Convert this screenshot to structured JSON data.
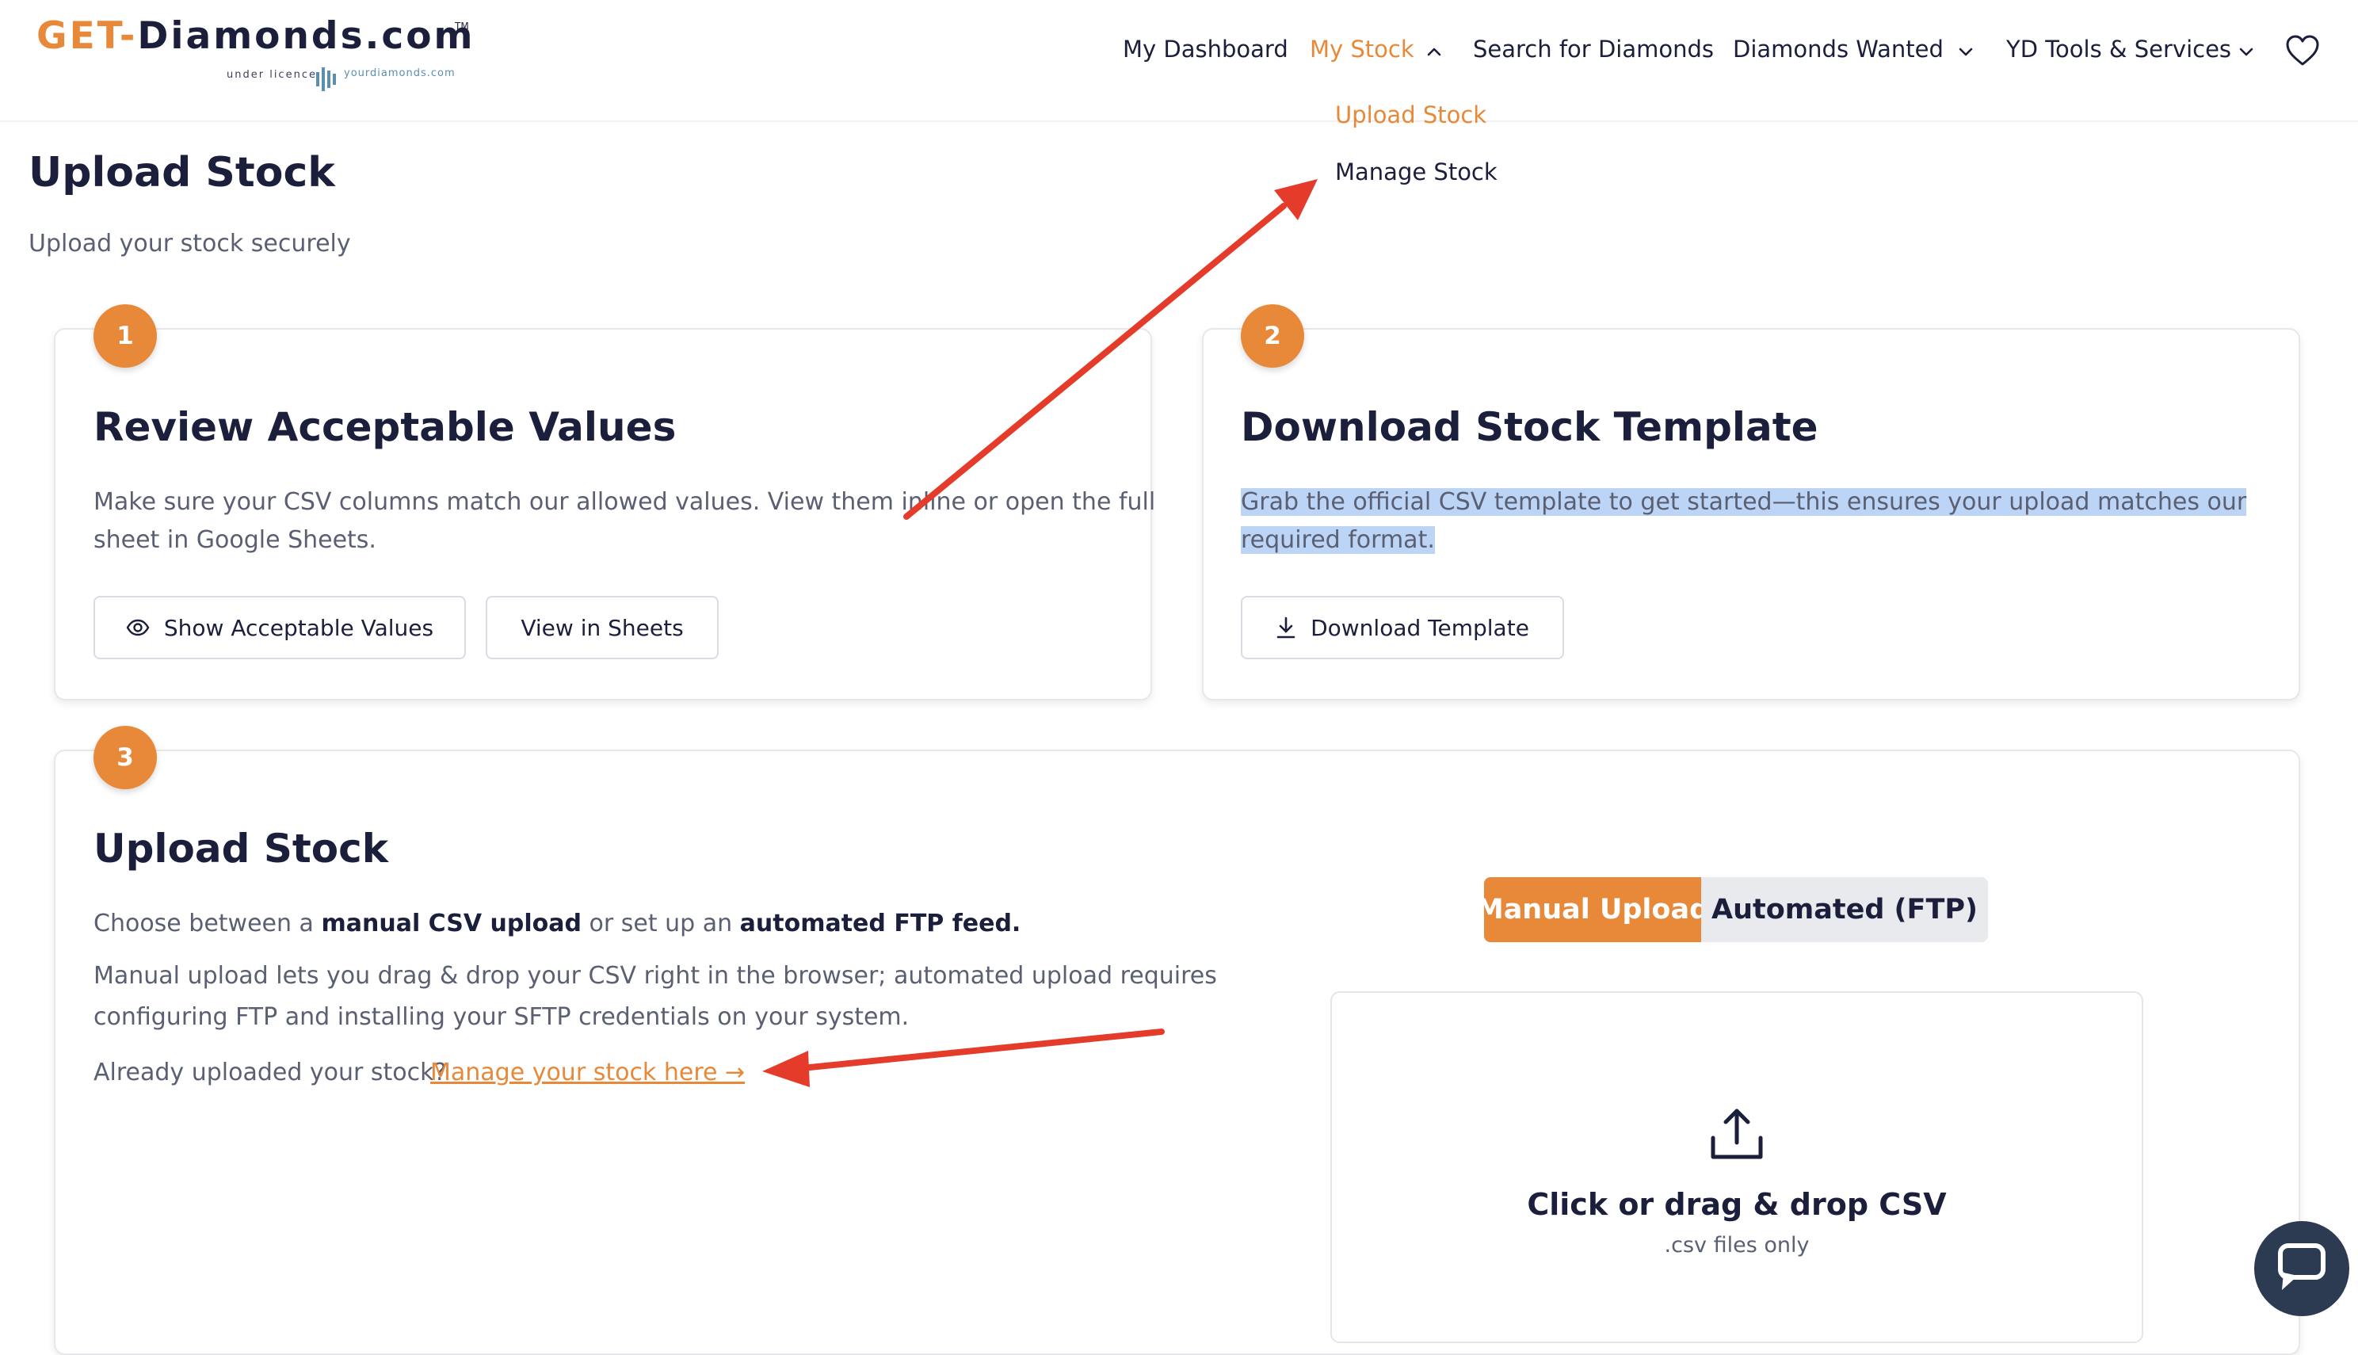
{
  "header": {
    "logo": {
      "get": "GET",
      "dash": "-",
      "rest": "Diamonds.com",
      "tm": "TM",
      "under_licence": "under licence",
      "partner": "yourdiamonds.com"
    },
    "nav": [
      {
        "label": "My Dashboard",
        "has_chevron": false
      },
      {
        "label": "My Stock",
        "has_chevron": true,
        "active": true,
        "chevron": "chevron-up-icon"
      },
      {
        "label": "Search for Diamonds",
        "has_chevron": false
      },
      {
        "label": "Diamonds Wanted",
        "has_chevron": true,
        "chevron": "chevron-down-icon"
      },
      {
        "label": "YD Tools & Services",
        "has_chevron": true,
        "chevron": "chevron-down-icon"
      }
    ],
    "wishlist_icon": "heart-icon",
    "dropdown": [
      {
        "label": "Upload Stock",
        "active": true
      },
      {
        "label": "Manage Stock",
        "active": false
      }
    ]
  },
  "page": {
    "title": "Upload Stock",
    "subtitle": "Upload your stock securely"
  },
  "card1": {
    "step": "1",
    "title": "Review Acceptable Values",
    "text_line1": "Make sure your CSV columns match our allowed values. View them inline or open the full",
    "text_line2": "sheet in Google Sheets.",
    "btn_show": "Show Acceptable Values",
    "btn_show_icon": "eye-icon",
    "btn_sheets": "View in Sheets"
  },
  "card2": {
    "step": "2",
    "title": "Download Stock Template",
    "text_line1": "Grab the official CSV template to get started—this ensures your upload matches our",
    "text_line2": "required format.",
    "btn_download": "Download Template",
    "btn_download_icon": "download-icon"
  },
  "card3": {
    "step": "3",
    "title": "Upload Stock",
    "p1_a": "Choose between a ",
    "p1_b": "manual CSV upload",
    "p1_c": " or set up an ",
    "p1_d": "automated FTP feed.",
    "p2_line1": "Manual upload lets you drag & drop your CSV right in the browser; automated upload requires",
    "p2_line2": "configuring FTP and installing your SFTP credentials on your system.",
    "p3_text": "Already uploaded your stock?",
    "p3_link": "Manage your stock here →",
    "toggle_manual": "Manual Upload",
    "toggle_auto": "Automated (FTP)",
    "upload_icon": "upload-icon",
    "dz_title": "Click or drag & drop CSV",
    "dz_sub": ".csv files only"
  },
  "annotations": {
    "arrow_color": "#e43b2b",
    "arrows": [
      "arrow-to-manage-stock",
      "arrow-to-manage-link"
    ]
  },
  "chat": {
    "icon": "chat-icon"
  },
  "colors": {
    "accent": "#e8893a",
    "text": "#1b1f3b",
    "muted": "#5a5f72",
    "highlight": "#bcd4f5",
    "arrow": "#e43b2b"
  }
}
